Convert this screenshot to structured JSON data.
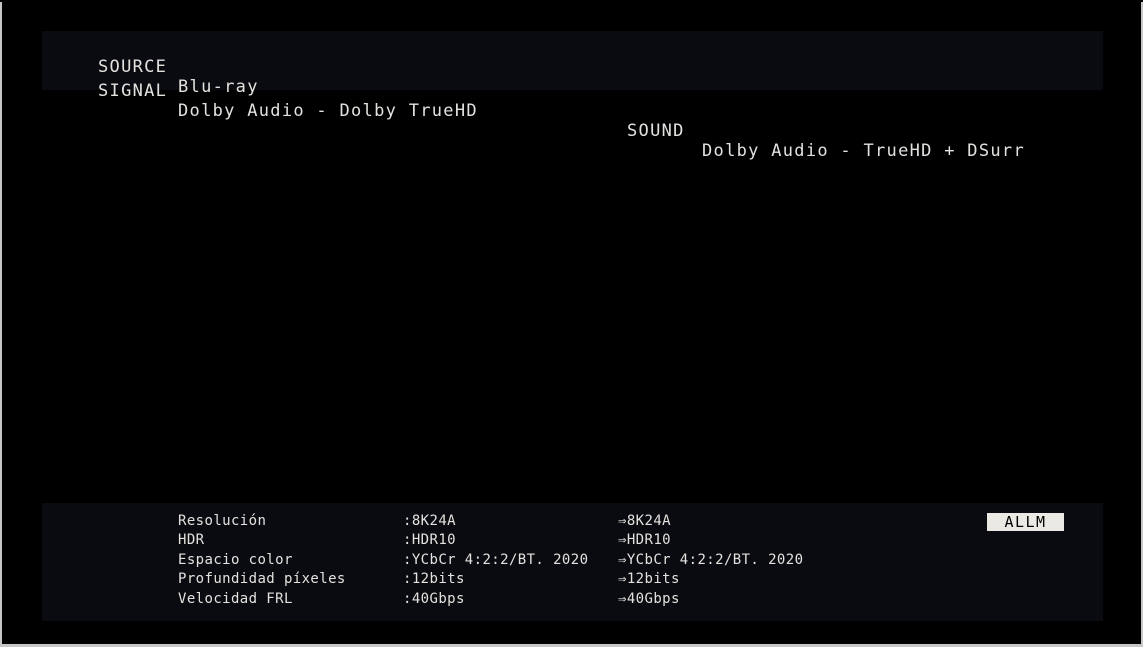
{
  "top_band": {
    "source_label": "SOURCE",
    "source_value": "Blu-ray",
    "signal_label": "SIGNAL",
    "signal_value": "Dolby Audio - Dolby TrueHD",
    "sound_label": "SOUND",
    "sound_value": "Dolby Audio - TrueHD + DSurr"
  },
  "bottom_band": {
    "rows": [
      {
        "label": "Resolución",
        "input": ":8K24A",
        "output": "⇒8K24A"
      },
      {
        "label": "HDR",
        "input": ":HDR10",
        "output": "⇒HDR10"
      },
      {
        "label": "Espacio color",
        "input": ":YCbCr 4:2:2/BT. 2020",
        "output": "⇒YCbCr 4:2:2/BT. 2020"
      },
      {
        "label": "Profundidad píxeles",
        "input": ":12bits",
        "output": "⇒12bits"
      },
      {
        "label": "Velocidad FRL",
        "input": ":40Gbps",
        "output": "⇒40Gbps"
      }
    ],
    "badge": "ALLM"
  },
  "colors": {
    "bg": "#000000",
    "band-bg": "#0a0b10",
    "text": "#e3e2de",
    "badge-bg": "#ebe9e4",
    "badge-text": "#000000",
    "frame": "#c6c6c4"
  }
}
